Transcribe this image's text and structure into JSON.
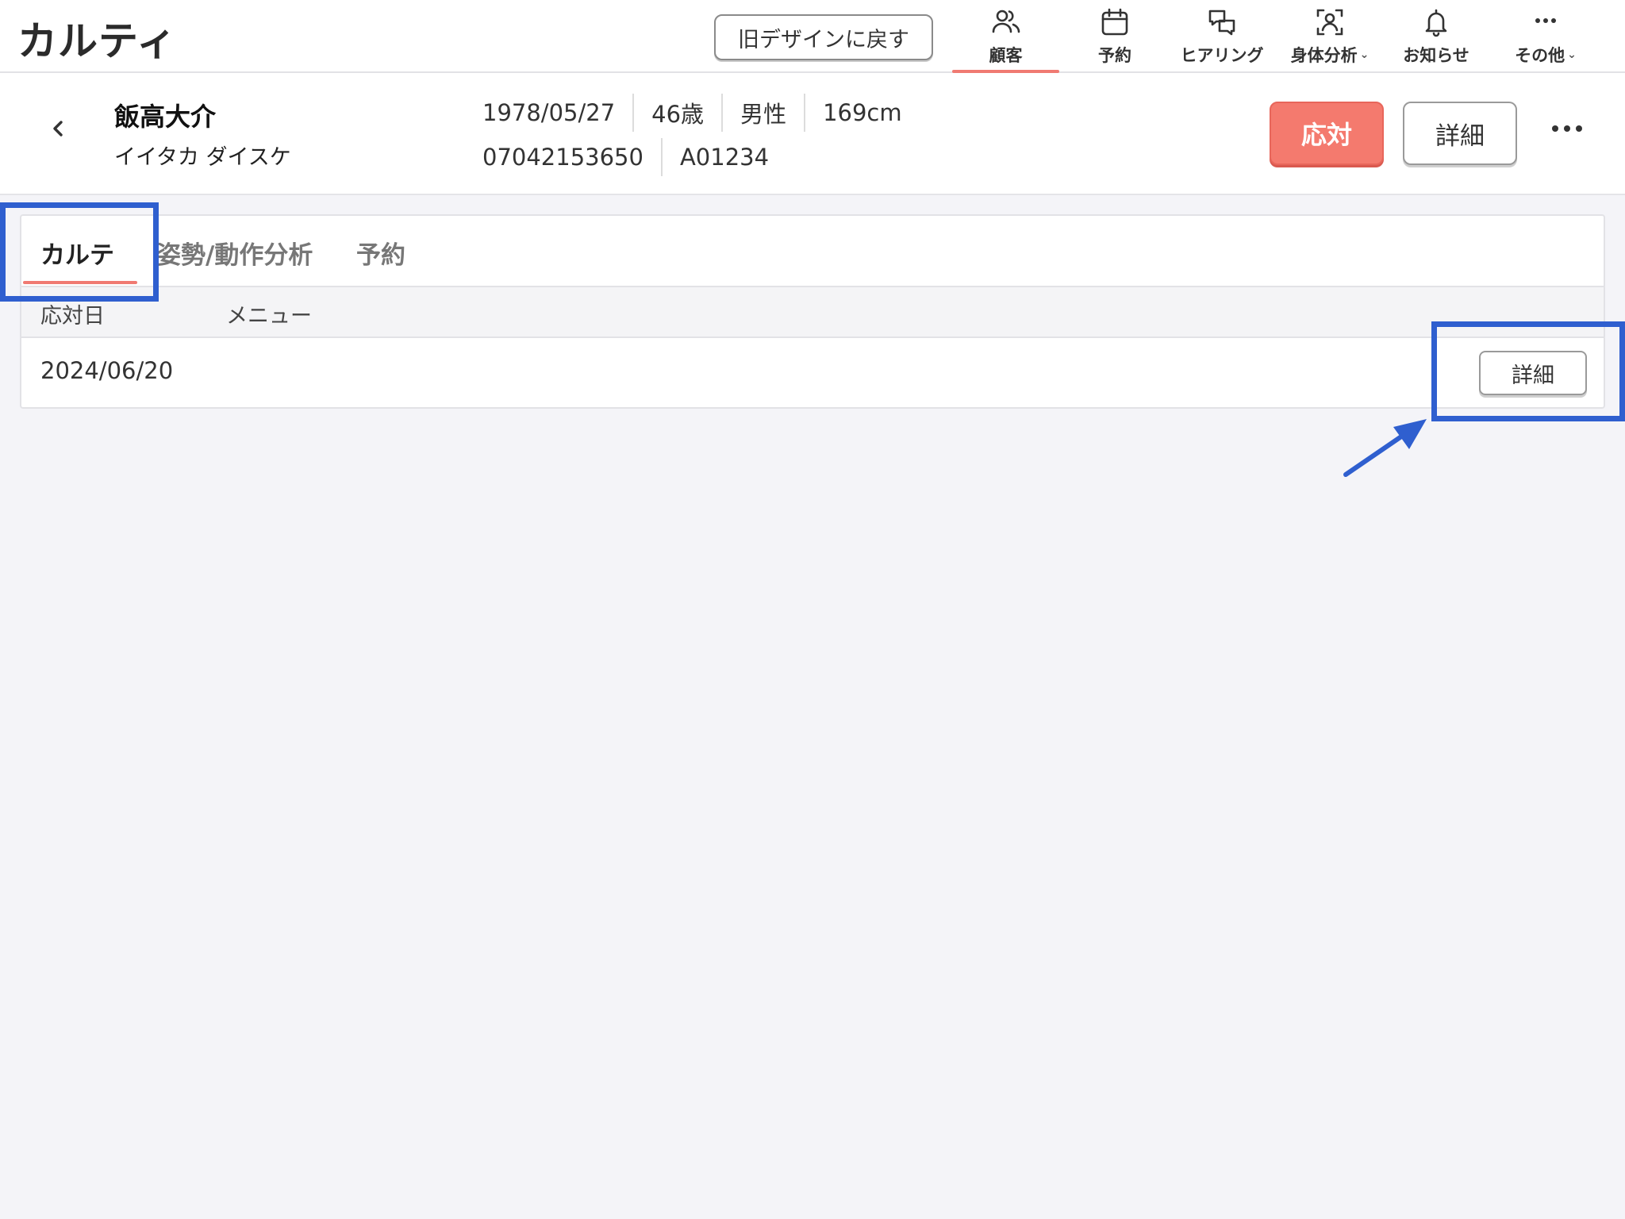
{
  "app": {
    "title": "カルティ"
  },
  "topbar": {
    "old_design_label": "旧デザインに戻す",
    "nav": [
      {
        "label": "顧客",
        "icon": "users-icon",
        "active": true
      },
      {
        "label": "予約",
        "icon": "calendar-icon"
      },
      {
        "label": "ヒアリング",
        "icon": "chat-icon"
      },
      {
        "label": "身体分析",
        "icon": "body-scan-icon",
        "has_dropdown": true
      },
      {
        "label": "お知らせ",
        "icon": "bell-icon"
      },
      {
        "label": "その他",
        "icon": "ellipsis-icon",
        "has_dropdown": true
      }
    ]
  },
  "customer": {
    "name": "飯高大介",
    "kana": "イイタカ ダイスケ",
    "birthdate": "1978/05/27",
    "age": "46歳",
    "gender": "男性",
    "height": "169cm",
    "phone": "07042153650",
    "id": "A01234"
  },
  "actions": {
    "taiou_label": "応対",
    "detail_label": "詳細"
  },
  "tabs": [
    {
      "label": "カルテ",
      "active": true
    },
    {
      "label": "姿勢/動作分析"
    },
    {
      "label": "予約"
    }
  ],
  "table": {
    "headers": [
      "応対日",
      "メニュー"
    ],
    "rows": [
      {
        "date": "2024/06/20",
        "menu": "",
        "action_label": "詳細"
      }
    ]
  },
  "colors": {
    "accent": "#f47a6e",
    "highlight": "#2f5fcf"
  }
}
